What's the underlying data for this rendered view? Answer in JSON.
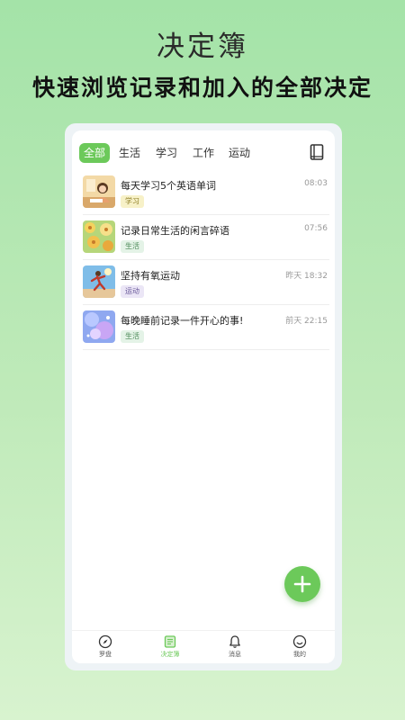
{
  "promo": {
    "title": "决定簿",
    "subtitle": "快速浏览记录和加入的全部决定"
  },
  "tabs": [
    {
      "label": "全部",
      "active": true
    },
    {
      "label": "生活",
      "active": false
    },
    {
      "label": "学习",
      "active": false
    },
    {
      "label": "工作",
      "active": false
    },
    {
      "label": "运动",
      "active": false
    }
  ],
  "toolbar": {
    "icon": "book-icon"
  },
  "entries": [
    {
      "title": "每天学习5个英语单词",
      "time": "08:03",
      "tag": "学习",
      "tag_color": "#f7f1c8",
      "tag_text_color": "#8a7a20",
      "thumb": "girl-studying-image"
    },
    {
      "title": "记录日常生活的闲言碎语",
      "time": "07:56",
      "tag": "生活",
      "tag_color": "#e4f3e7",
      "tag_text_color": "#4c8a58",
      "thumb": "flowers-image"
    },
    {
      "title": "坚持有氧运动",
      "time": "昨天 18:32",
      "tag": "运动",
      "tag_color": "#ebe6f6",
      "tag_text_color": "#6a5a9a",
      "thumb": "runner-image"
    },
    {
      "title": "每晚睡前记录一件开心的事!",
      "time": "前天 22:15",
      "tag": "生活",
      "tag_color": "#e4f3e7",
      "tag_text_color": "#4c8a58",
      "thumb": "night-dream-image"
    }
  ],
  "fab": {
    "icon": "plus-icon"
  },
  "bottom_nav": [
    {
      "label": "罗盘",
      "icon": "compass-icon",
      "active": false
    },
    {
      "label": "决定簿",
      "icon": "notebook-icon",
      "active": true
    },
    {
      "label": "消息",
      "icon": "bell-icon",
      "active": false
    },
    {
      "label": "我的",
      "icon": "smiley-icon",
      "active": false
    }
  ],
  "colors": {
    "accent": "#6cc95a",
    "background_top": "#a4e3a8",
    "background_bottom": "#d8f3cf"
  }
}
